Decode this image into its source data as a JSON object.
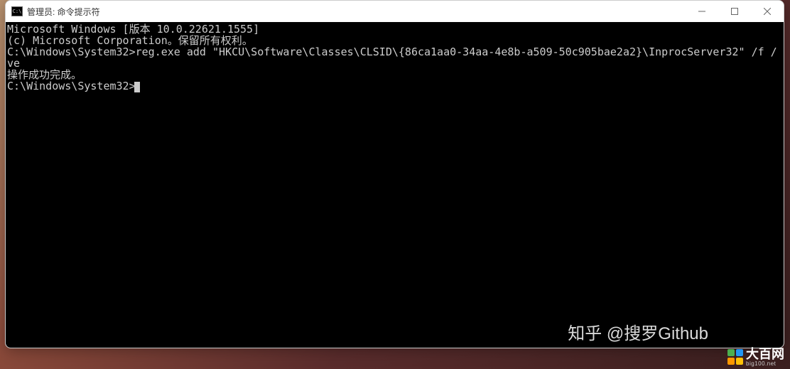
{
  "window": {
    "title": "管理员: 命令提示符"
  },
  "terminal": {
    "line1": "Microsoft Windows [版本 10.0.22621.1555]",
    "line2": "(c) Microsoft Corporation。保留所有权利。",
    "line3": "",
    "line4": "C:\\Windows\\System32>reg.exe add \"HKCU\\Software\\Classes\\CLSID\\{86ca1aa0-34aa-4e8b-a509-50c905bae2a2}\\InprocServer32\" /f /ve",
    "line5": "操作成功完成。",
    "line6": "",
    "prompt": "C:\\Windows\\System32>"
  },
  "watermarks": {
    "zhihu": "知乎 @搜罗Github",
    "dabai_main": "大百网",
    "dabai_sub": "big100.net"
  }
}
